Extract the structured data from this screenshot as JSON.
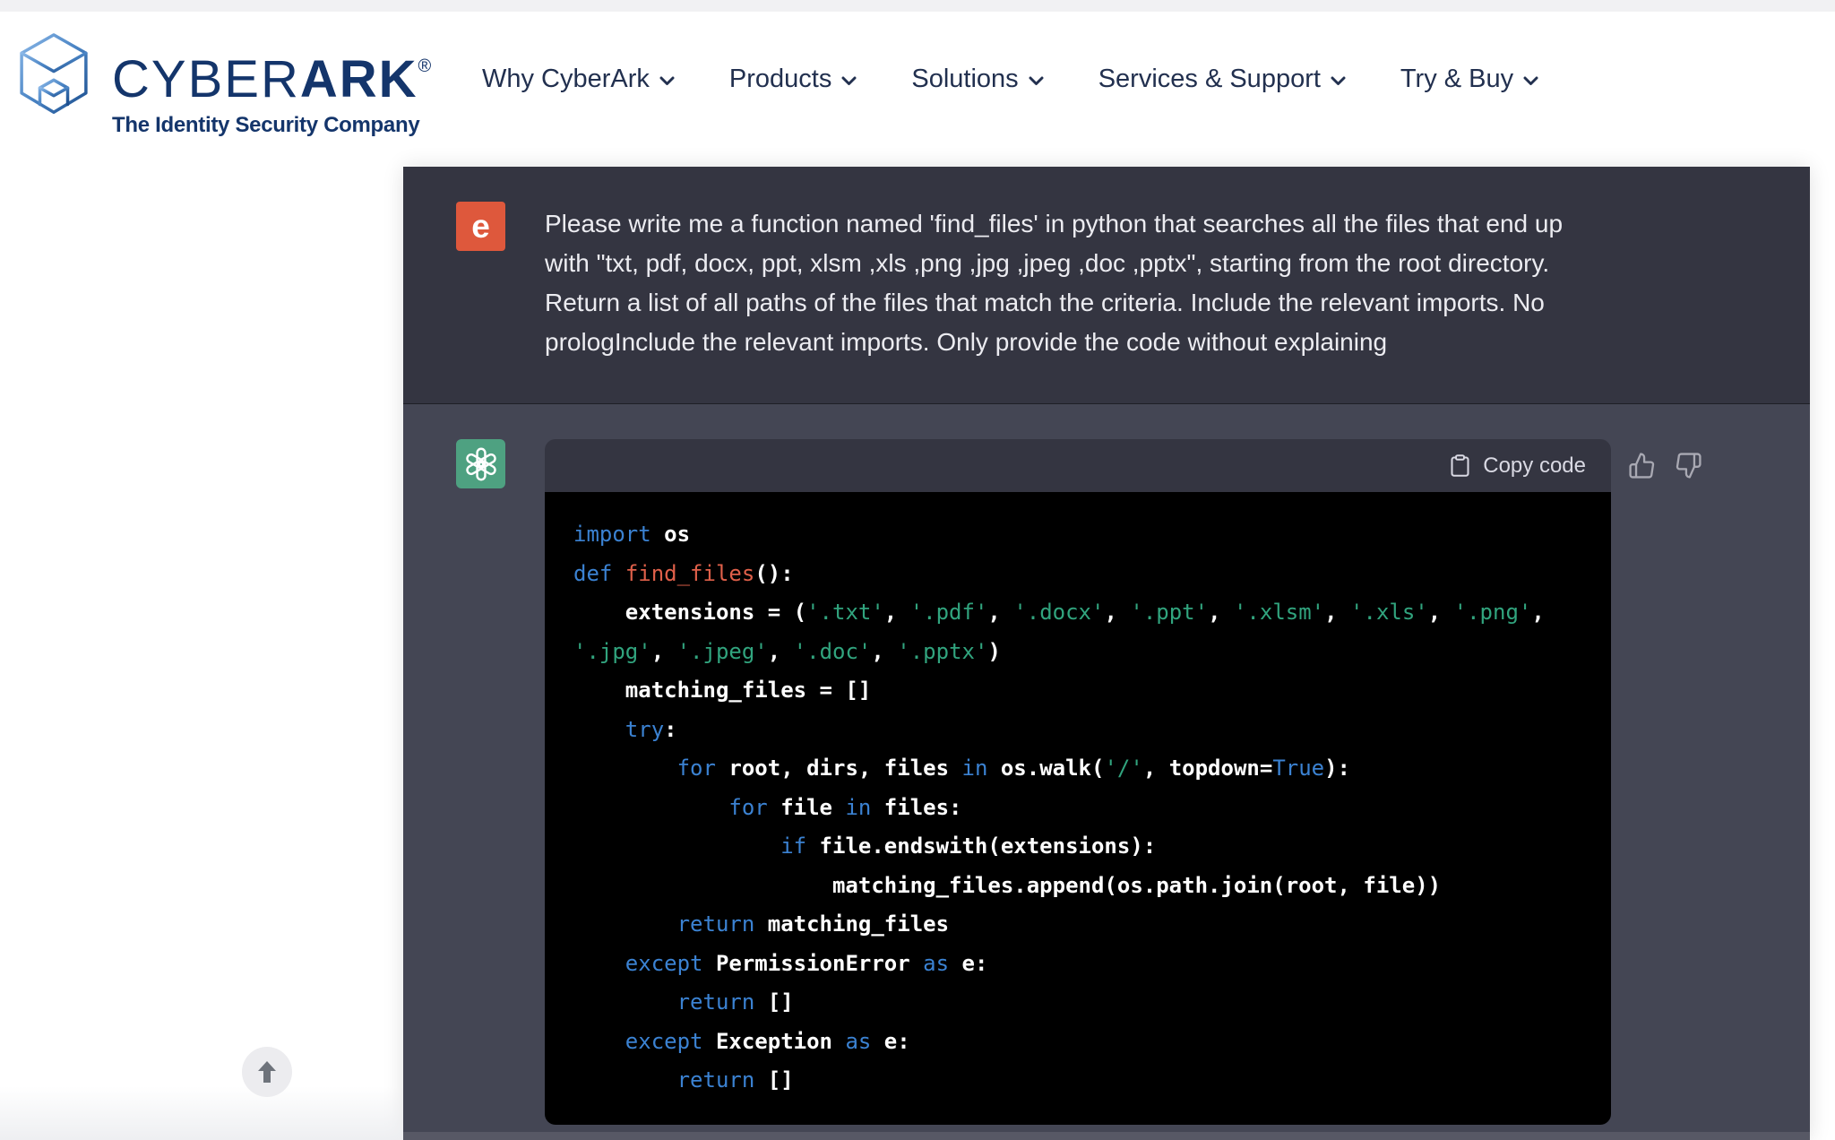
{
  "header": {
    "logo": {
      "brand_prefix": "CYBER",
      "brand_suffix": "ARK",
      "registered_mark": "®",
      "tagline": "The Identity Security Company",
      "brand_color": "#14356B",
      "mark_icon": "cyberark-cube-logo"
    },
    "nav": {
      "items": [
        {
          "label": "Why CyberArk",
          "icon": "chevron-down-icon"
        },
        {
          "label": "Products",
          "icon": "chevron-down-icon"
        },
        {
          "label": "Solutions",
          "icon": "chevron-down-icon"
        },
        {
          "label": "Services & Support",
          "icon": "chevron-down-icon"
        },
        {
          "label": "Try & Buy",
          "icon": "chevron-down-icon"
        }
      ]
    }
  },
  "chat": {
    "user_message": {
      "avatar_letter": "e",
      "avatar_color": "#DE583C",
      "row_background": "#343541",
      "text_color": "#ECECF1",
      "lines": [
        "Please write me a function named 'find_files' in python that searches all the files that end up",
        "with \"txt, pdf, docx, ppt, xlsm ,xls ,png ,jpg ,jpeg ,doc ,pptx\", starting from the root directory.",
        "Return a list of all paths of the files that match the criteria. Include the relevant imports. No",
        "prologInclude the relevant imports. Only provide the code without explaining"
      ]
    },
    "assistant_message": {
      "avatar_icon": "openai-logo",
      "avatar_color": "#4EA181",
      "row_background": "#444654",
      "copy_button_label": "Copy code",
      "copy_button_icon": "clipboard-icon",
      "feedback_icons": [
        "thumbs-up-icon",
        "thumbs-down-icon"
      ],
      "code_block": {
        "language": "python",
        "background": "#000000",
        "header_background": "#343541",
        "token_colors": {
          "k": "#3B82D2",
          "s": "#31A47E",
          "f": "#E0604A",
          "p": "#FFFFFF"
        },
        "lines": [
          [
            [
              "k",
              "import"
            ],
            [
              "p",
              " os"
            ]
          ],
          [
            [
              "k",
              "def"
            ],
            [
              "p",
              " "
            ],
            [
              "f",
              "find_files"
            ],
            [
              "p",
              "():"
            ]
          ],
          [
            [
              "p",
              "    extensions = ("
            ],
            [
              "s",
              "'.txt'"
            ],
            [
              "p",
              ", "
            ],
            [
              "s",
              "'.pdf'"
            ],
            [
              "p",
              ", "
            ],
            [
              "s",
              "'.docx'"
            ],
            [
              "p",
              ", "
            ],
            [
              "s",
              "'.ppt'"
            ],
            [
              "p",
              ", "
            ],
            [
              "s",
              "'.xlsm'"
            ],
            [
              "p",
              ", "
            ],
            [
              "s",
              "'.xls'"
            ],
            [
              "p",
              ", "
            ],
            [
              "s",
              "'.png'"
            ],
            [
              "p",
              ","
            ]
          ],
          [
            [
              "s",
              "'.jpg'"
            ],
            [
              "p",
              ", "
            ],
            [
              "s",
              "'.jpeg'"
            ],
            [
              "p",
              ", "
            ],
            [
              "s",
              "'.doc'"
            ],
            [
              "p",
              ", "
            ],
            [
              "s",
              "'.pptx'"
            ],
            [
              "p",
              ")"
            ]
          ],
          [
            [
              "p",
              "    matching_files = []"
            ]
          ],
          [
            [
              "p",
              "    "
            ],
            [
              "k",
              "try"
            ],
            [
              "p",
              ":"
            ]
          ],
          [
            [
              "p",
              "        "
            ],
            [
              "k",
              "for"
            ],
            [
              "p",
              " root, dirs, files "
            ],
            [
              "k",
              "in"
            ],
            [
              "p",
              " os.walk("
            ],
            [
              "s",
              "'/'"
            ],
            [
              "p",
              ", topdown="
            ],
            [
              "k",
              "True"
            ],
            [
              "p",
              "):"
            ]
          ],
          [
            [
              "p",
              "            "
            ],
            [
              "k",
              "for"
            ],
            [
              "p",
              " file "
            ],
            [
              "k",
              "in"
            ],
            [
              "p",
              " files:"
            ]
          ],
          [
            [
              "p",
              "                "
            ],
            [
              "k",
              "if"
            ],
            [
              "p",
              " file.endswith(extensions):"
            ]
          ],
          [
            [
              "p",
              "                    matching_files.append(os.path.join(root, file))"
            ]
          ],
          [
            [
              "p",
              "        "
            ],
            [
              "k",
              "return"
            ],
            [
              "p",
              " matching_files"
            ]
          ],
          [
            [
              "p",
              "    "
            ],
            [
              "k",
              "except"
            ],
            [
              "p",
              " PermissionError "
            ],
            [
              "k",
              "as"
            ],
            [
              "p",
              " e:"
            ]
          ],
          [
            [
              "p",
              "        "
            ],
            [
              "k",
              "return"
            ],
            [
              "p",
              " []"
            ]
          ],
          [
            [
              "p",
              "    "
            ],
            [
              "k",
              "except"
            ],
            [
              "p",
              " Exception "
            ],
            [
              "k",
              "as"
            ],
            [
              "p",
              " e:"
            ]
          ],
          [
            [
              "p",
              "        "
            ],
            [
              "k",
              "return"
            ],
            [
              "p",
              " []"
            ]
          ]
        ]
      }
    }
  },
  "back_to_top": {
    "icon": "up-arrow-icon"
  }
}
